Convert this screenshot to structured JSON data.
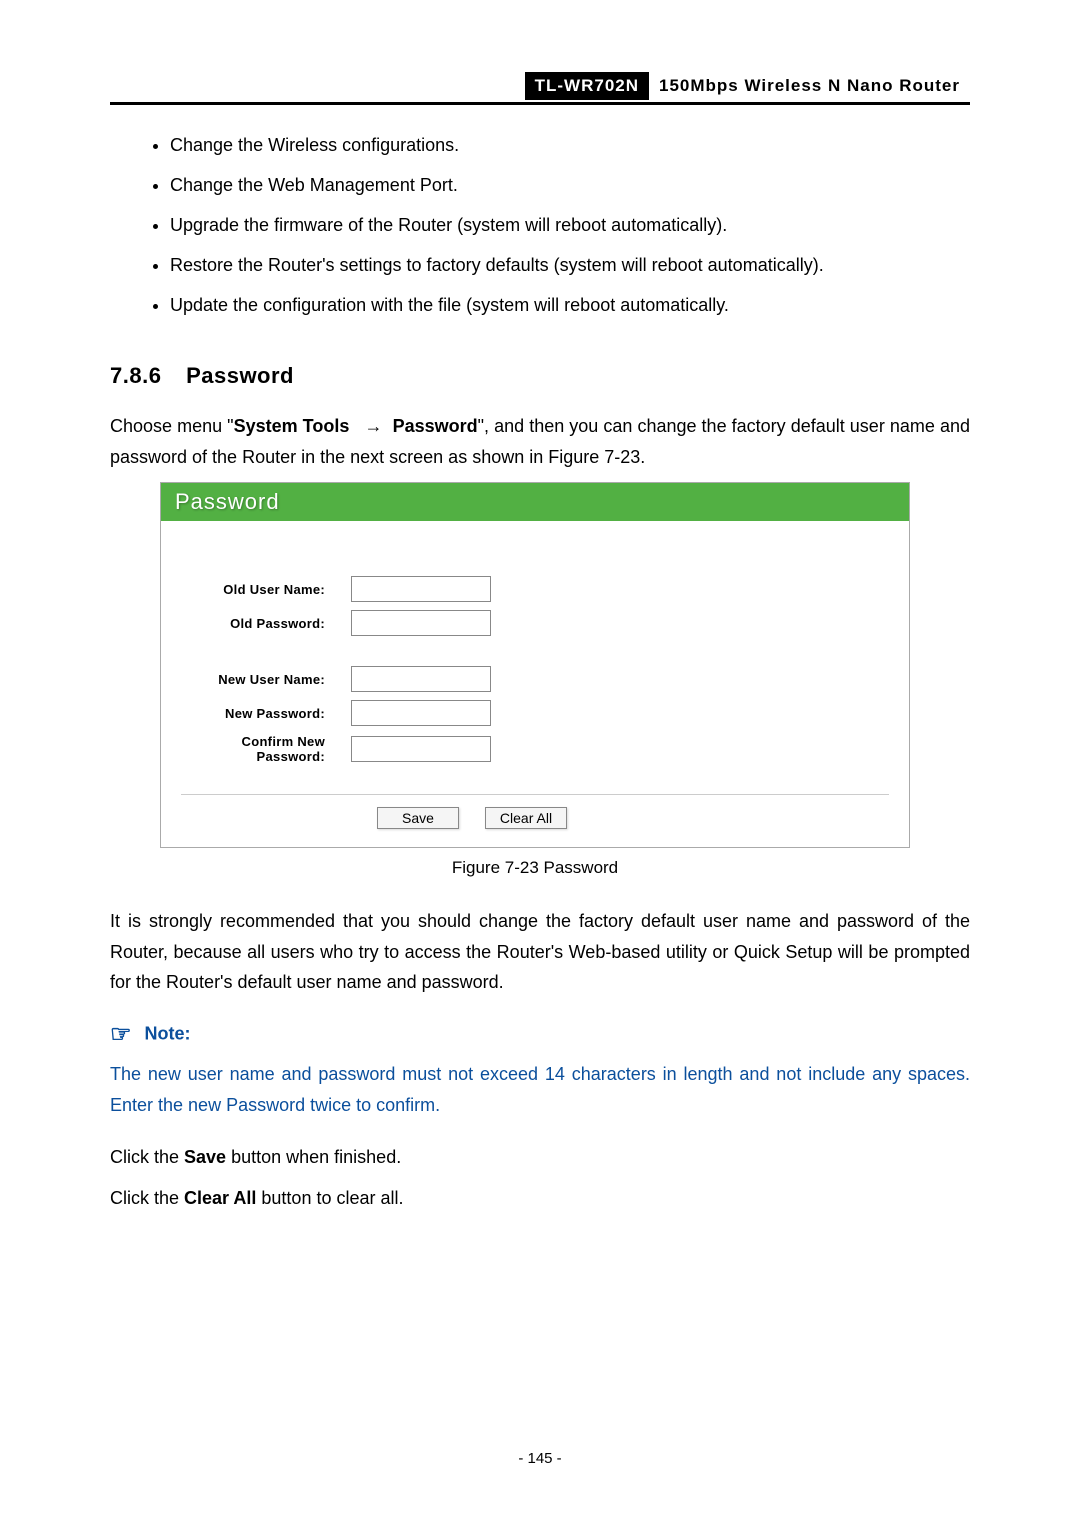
{
  "header": {
    "model": "TL-WR702N",
    "product": "150Mbps  Wireless  N  Nano  Router"
  },
  "bullets": [
    "Change the Wireless configurations.",
    "Change the Web Management Port.",
    "Upgrade the firmware of the Router (system will reboot automatically).",
    "Restore the Router's settings to factory defaults (system will reboot automatically).",
    "Update the configuration with the file (system will reboot automatically."
  ],
  "section": {
    "number": "7.8.6",
    "title": "Password"
  },
  "intro": {
    "pre": "Choose menu \"",
    "bold1": "System Tools",
    "arrow": "→",
    "bold2": "Password",
    "post": "\", and then you can change the factory default user name and password of the Router in the next screen as shown in Figure 7-23."
  },
  "figure": {
    "title": "Password",
    "labels": {
      "old_user": "Old User Name:",
      "old_pass": "Old Password:",
      "new_user": "New User Name:",
      "new_pass": "New Password:",
      "confirm": "Confirm New Password:"
    },
    "buttons": {
      "save": "Save",
      "clear": "Clear All"
    },
    "caption": "Figure 7-23    Password"
  },
  "para2": "It is strongly recommended that you should change the factory default user name and password of the Router, because all users who try to access the Router's Web-based utility or Quick Setup will be prompted for the Router's default user name and password.",
  "note": {
    "heading": "Note:",
    "text": "The new user name and password must not exceed 14 characters in length and not include any spaces. Enter the new Password twice to confirm."
  },
  "click_save": {
    "pre": "Click the ",
    "bold": "Save",
    "post": " button when finished."
  },
  "click_clear": {
    "pre": "Click the ",
    "bold": "Clear All",
    "post": " button to clear all."
  },
  "page_number": "- 145 -"
}
